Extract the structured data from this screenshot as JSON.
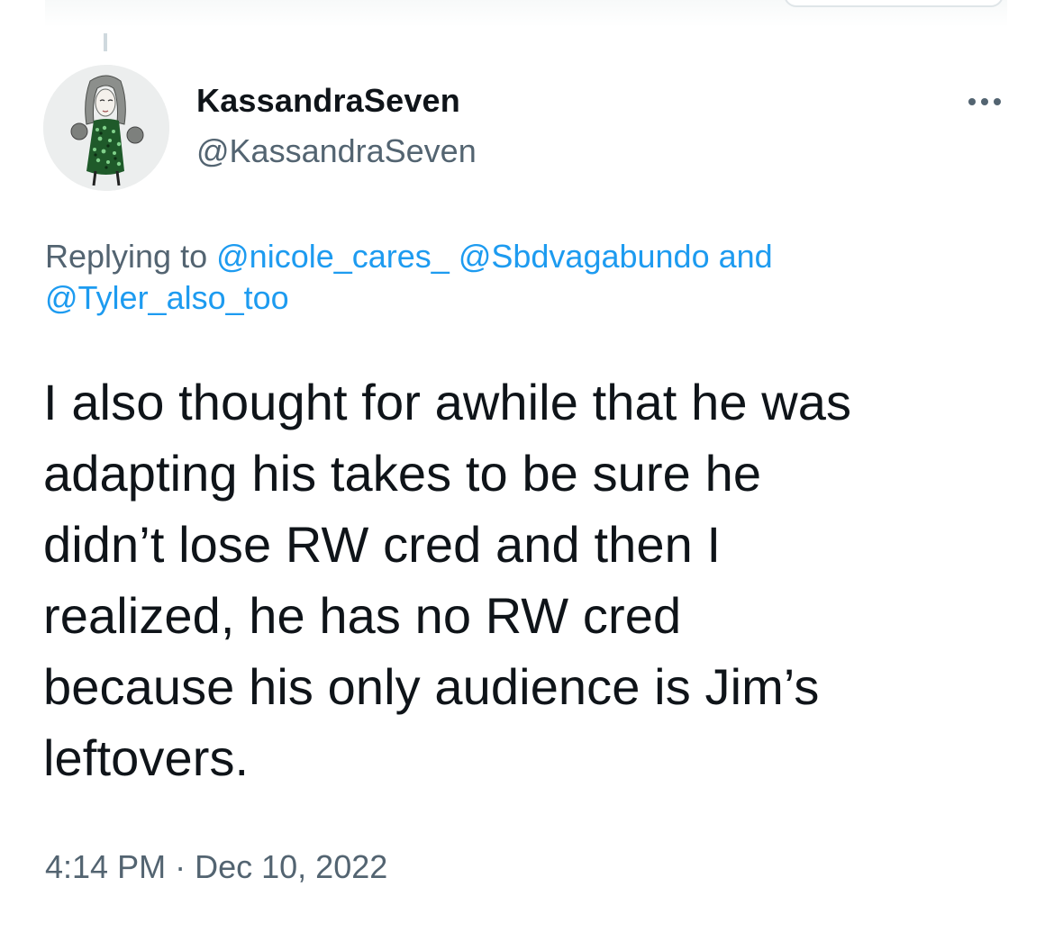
{
  "author": {
    "display_name": "KassandraSeven",
    "handle": "@KassandraSeven",
    "avatar_icon": "profile-avatar-illustration"
  },
  "more_icon": "more-horizontal-icon",
  "reply_context": {
    "prefix": "Replying to",
    "mentions": [
      "@nicole_cares_",
      "@Sbdvagabundo",
      "@Tyler_also_too"
    ],
    "conjunction": "and"
  },
  "tweet": {
    "lines": [
      "I also thought for awhile that he was",
      "adapting his takes to be sure he",
      "didn’t lose RW cred and then I",
      "realized, he has no RW cred",
      "because his only audience is Jim’s",
      "leftovers."
    ]
  },
  "meta": {
    "time": "4:14 PM",
    "separator": "·",
    "date": "Dec 10, 2022"
  },
  "colors": {
    "link": "#1d9bf0",
    "secondary_text": "#536471",
    "primary_text": "#0f1419"
  }
}
